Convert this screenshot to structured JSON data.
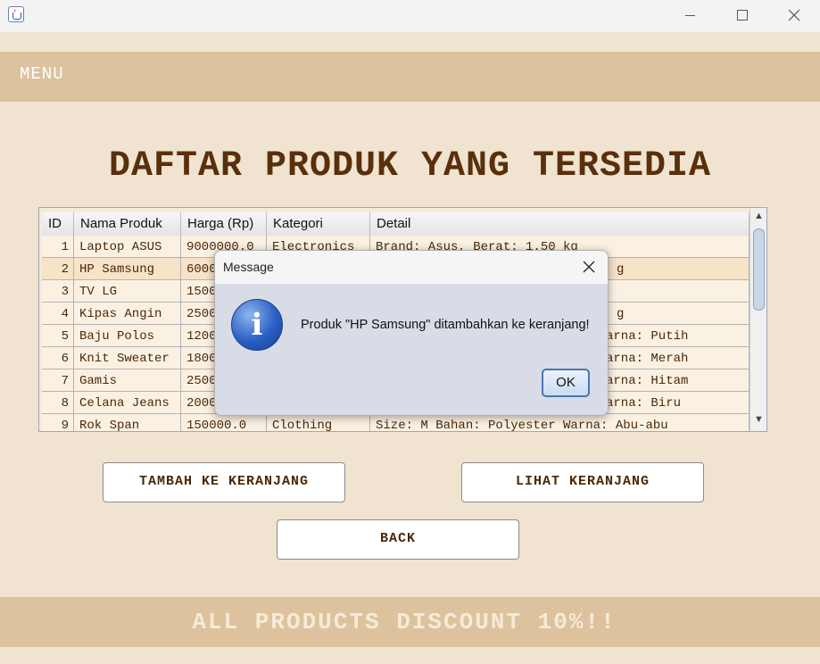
{
  "window": {
    "icon": "java-cup-icon"
  },
  "menu": {
    "label": "MENU"
  },
  "heading": "DAFTAR PRODUK YANG TERSEDIA",
  "table": {
    "columns": [
      "ID",
      "Nama Produk",
      "Harga (Rp)",
      "Kategori",
      "Detail"
    ],
    "rows": [
      {
        "id": "1",
        "name": "Laptop ASUS",
        "price": "9000000.0",
        "category": "Electronics",
        "detail": "Brand: Asus, Berat: 1.50 kg"
      },
      {
        "id": "2",
        "name": "HP Samsung",
        "price": "6000",
        "category": "",
        "detail": "g"
      },
      {
        "id": "3",
        "name": "TV LG",
        "price": "1500",
        "category": "",
        "detail": ""
      },
      {
        "id": "4",
        "name": "Kipas Angin",
        "price": "2500",
        "category": "",
        "detail": "g"
      },
      {
        "id": "5",
        "name": "Baju Polos",
        "price": "1200",
        "category": "",
        "detail": "arna: Putih"
      },
      {
        "id": "6",
        "name": "Knit Sweater",
        "price": "1800",
        "category": "",
        "detail": "arna: Merah"
      },
      {
        "id": "7",
        "name": "Gamis",
        "price": "2500",
        "category": "",
        "detail": "arna: Hitam"
      },
      {
        "id": "8",
        "name": "Celana Jeans",
        "price": "2000",
        "category": "",
        "detail": "arna: Biru"
      },
      {
        "id": "9",
        "name": "Rok Span",
        "price": "150000.0",
        "category": "Clothing",
        "detail": "Size: M    Bahan: Polyester Warna: Abu-abu"
      }
    ]
  },
  "buttons": {
    "add_to_cart": "TAMBAH KE KERANJANG",
    "view_cart": "LIHAT KERANJANG",
    "back": "BACK"
  },
  "footer": "ALL PRODUCTS DISCOUNT 10%!!",
  "dialog": {
    "title": "Message",
    "message": "Produk \"HP Samsung\" ditambahkan ke keranjang!",
    "ok": "OK",
    "icon": "info-icon"
  },
  "colors": {
    "background": "#f0e4d0",
    "band": "#dcc39e",
    "text_brown": "#5a2f0c"
  }
}
